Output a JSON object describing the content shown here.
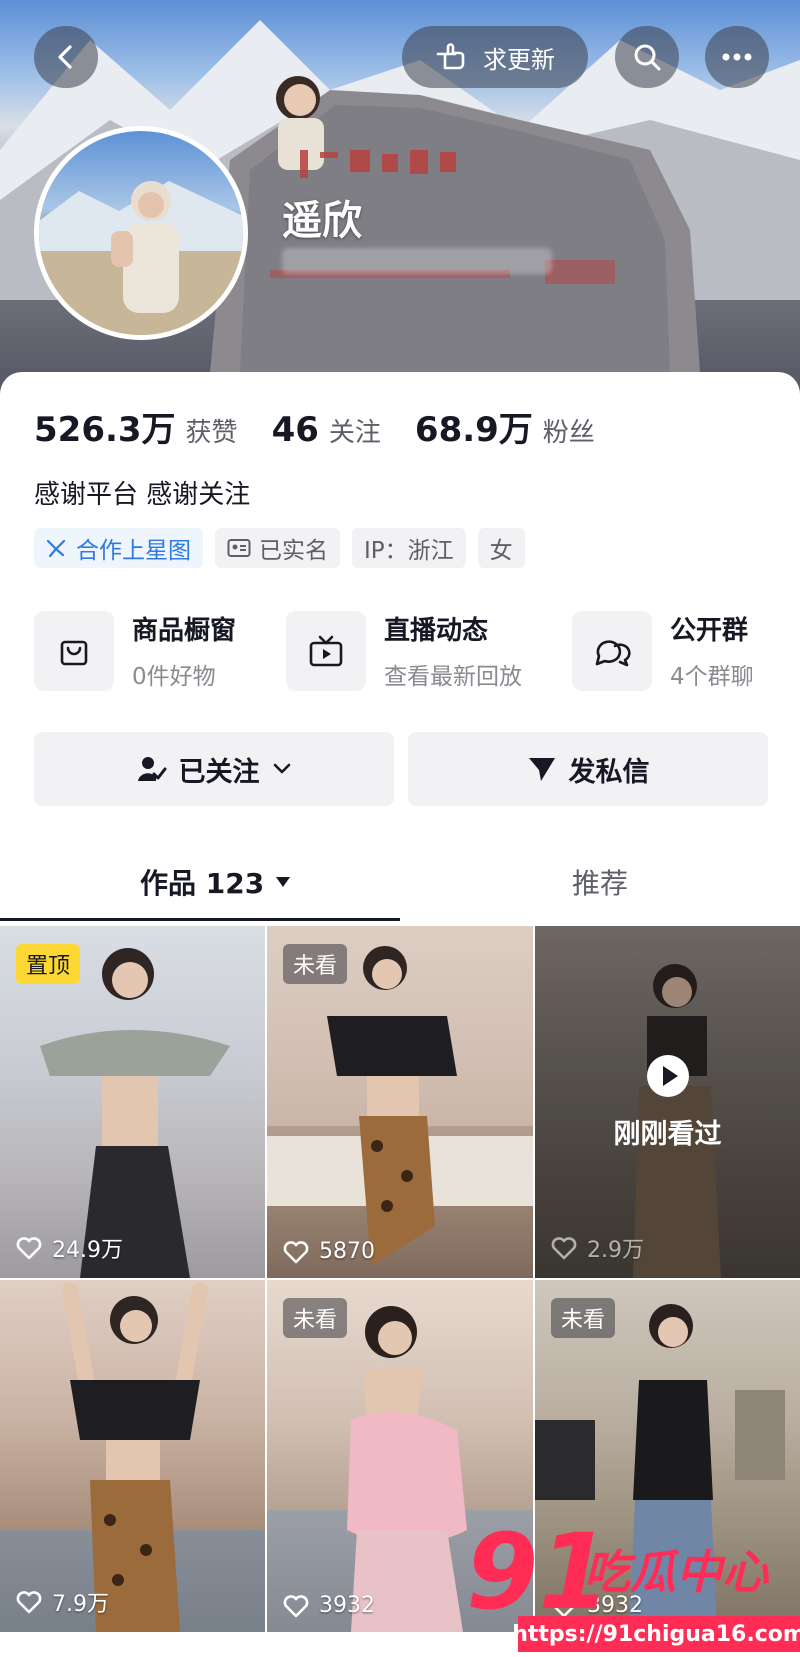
{
  "header": {
    "back_icon": "chevron-left-icon",
    "request_update_label": "求更新",
    "request_update_icon": "pointing-hand-icon",
    "search_icon": "search-icon",
    "more_icon": "more-horizontal-icon"
  },
  "profile": {
    "name": "遥欣",
    "stats": [
      {
        "value": "526.3万",
        "label": "获赞"
      },
      {
        "value": "46",
        "label": "关注"
      },
      {
        "value": "68.9万",
        "label": "粉丝"
      }
    ],
    "bio": "感谢平台 感谢关注",
    "tags": [
      {
        "label": "合作上星图",
        "icon": "star-map-icon",
        "color": "#2e7ae0"
      },
      {
        "label": "已实名",
        "icon": "id-card-icon"
      },
      {
        "label": "IP：浙江"
      },
      {
        "label": "女"
      }
    ]
  },
  "services": [
    {
      "title": "商品橱窗",
      "subtitle": "0件好物",
      "icon": "shopping-bag-icon"
    },
    {
      "title": "直播动态",
      "subtitle": "查看最新回放",
      "icon": "tv-play-icon"
    },
    {
      "title": "公开群",
      "subtitle": "4个群聊",
      "icon": "chat-bubbles-icon"
    }
  ],
  "actions": {
    "followed_label": "已关注",
    "message_label": "发私信"
  },
  "tabs": {
    "works_label": "作品 123",
    "recommend_label": "推荐"
  },
  "videos": [
    {
      "badge": "置顶",
      "likes": "24.9万"
    },
    {
      "badge": "未看",
      "likes": "5870"
    },
    {
      "overlay": "刚刚看过",
      "likes": "2.9万"
    },
    {
      "likes": "7.9万"
    },
    {
      "badge": "未看",
      "likes": "3932"
    },
    {
      "badge": "未看",
      "likes": "3932"
    }
  ],
  "watermark": {
    "number": "91",
    "brand": "吃瓜中心",
    "url": "https://91chigua16.com"
  },
  "colors": {
    "accent_red": "#ff2d55",
    "pin_yellow": "#fdd835",
    "tag_blue": "#2e7ae0"
  }
}
